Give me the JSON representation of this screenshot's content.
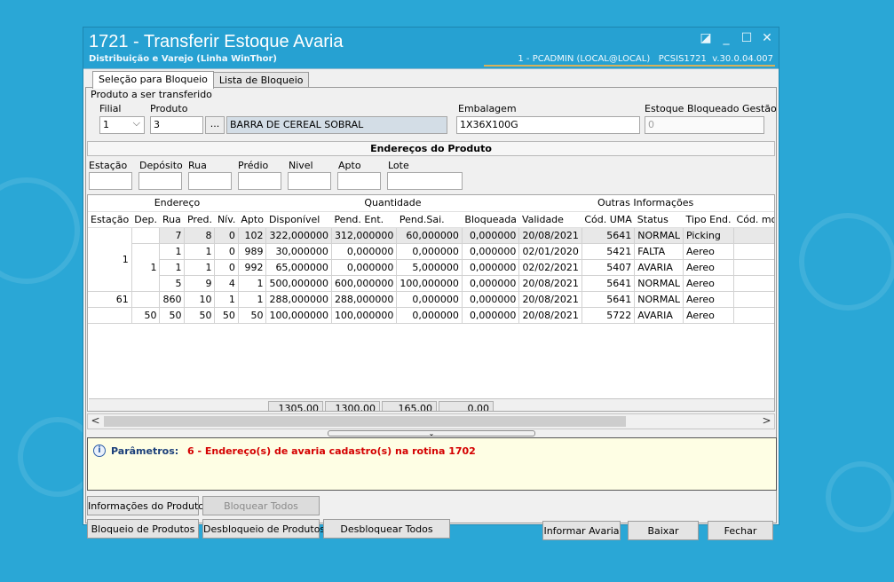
{
  "window": {
    "title": "1721 - Transferir Estoque Avaria",
    "subtitle": "Distribuição e Varejo (Linha WinThor)",
    "user_info": "1 - PCADMIN (LOCAL@LOCAL)   PCSIS1721  v.30.0.04.007",
    "controls": {
      "restore": "◪",
      "minimize": "_",
      "maximize": "☐",
      "close": "✕"
    }
  },
  "tabs": [
    {
      "label": "Seleção para Bloqueio",
      "active": true
    },
    {
      "label": "Lista de Bloqueio",
      "active": false
    }
  ],
  "produto_group": {
    "legend": "Produto a ser transferido",
    "filial_label": "Filial",
    "filial_value": "1",
    "filial_arrow": "⌵",
    "produto_label": "Produto",
    "produto_value": "3",
    "lookup_button": "...",
    "produto_desc": "BARRA DE CEREAL SOBRAL",
    "embalagem_label": "Embalagem",
    "embalagem_value": "1X36X100G",
    "estoque_label": "Estoque Bloqueado Gestão",
    "estoque_value": "0"
  },
  "enderecos": {
    "header": "Endereços do Produto",
    "filters": [
      {
        "label": "Estação",
        "value": ""
      },
      {
        "label": "Depósito",
        "value": ""
      },
      {
        "label": "Rua",
        "value": ""
      },
      {
        "label": "Prédio",
        "value": ""
      },
      {
        "label": "Nivel",
        "value": ""
      },
      {
        "label": "Apto",
        "value": ""
      },
      {
        "label": "Lote",
        "value": ""
      }
    ]
  },
  "grid": {
    "group_headers": [
      "Endereço",
      "Quantidade",
      "Outras Informações"
    ],
    "columns": [
      "Estação",
      "Dep.",
      "Rua",
      "Pred.",
      "Nív.",
      "Apto",
      "Disponível",
      "Pend. Ent.",
      "Pend.Sai.",
      "Bloqueada",
      "Validade",
      "Cód. UMA",
      "Status",
      "Tipo End.",
      "Cód. mot"
    ],
    "rows": [
      [
        "",
        "",
        "7",
        "8",
        "0",
        "102",
        "322,000000",
        "312,000000",
        "60,000000",
        "0,000000",
        "20/08/2021",
        "5641",
        "NORMAL",
        "Picking",
        ""
      ],
      [
        "",
        "",
        "1",
        "1",
        "0",
        "989",
        "30,000000",
        "0,000000",
        "0,000000",
        "0,000000",
        "02/01/2020",
        "5421",
        "FALTA",
        "Aereo",
        ""
      ],
      [
        "",
        "",
        "1",
        "1",
        "0",
        "992",
        "65,000000",
        "0,000000",
        "5,000000",
        "0,000000",
        "02/02/2021",
        "5407",
        "AVARIA",
        "Aereo",
        ""
      ],
      [
        "",
        "",
        "5",
        "9",
        "4",
        "1",
        "500,000000",
        "600,000000",
        "100,000000",
        "0,000000",
        "20/08/2021",
        "5641",
        "NORMAL",
        "Aereo",
        ""
      ],
      [
        "61",
        "",
        "860",
        "10",
        "1",
        "1",
        "288,000000",
        "288,000000",
        "0,000000",
        "0,000000",
        "20/08/2021",
        "5641",
        "NORMAL",
        "Aereo",
        ""
      ],
      [
        "",
        "50",
        "50",
        "50",
        "50",
        "50",
        "100,000000",
        "100,000000",
        "0,000000",
        "0,000000",
        "20/08/2021",
        "5722",
        "AVARIA",
        "Aereo",
        ""
      ]
    ],
    "merged_estacao": "1",
    "merged_dep": "1",
    "totals": {
      "disponivel": "1305,00",
      "pend_ent": "1300,00",
      "pend_sai": "165,00",
      "bloqueada": "0,00"
    },
    "scroll_left": "<",
    "scroll_right": ">",
    "splitter_glyph": "⌄"
  },
  "params": {
    "icon": "i",
    "label": "Parâmetros:",
    "text": "6 - Endereço(s) de avaria cadastro(s) na rotina 1702"
  },
  "buttons": {
    "informacoes_produto": "Informações do Produto",
    "bloquear_todos": "Bloquear Todos",
    "bloqueio_produtos": "Bloqueio de Produtos",
    "desbloqueio_produtos": "Desbloqueio de Produtos",
    "desbloquear_todos": "Desbloquear Todos",
    "informar_avaria": "Informar Avaria",
    "baixar": "Baixar",
    "fechar": "Fechar"
  },
  "colors": {
    "background": "#2aa7d6",
    "accent_line": "#d8b15a",
    "params_text": "#d40000"
  }
}
